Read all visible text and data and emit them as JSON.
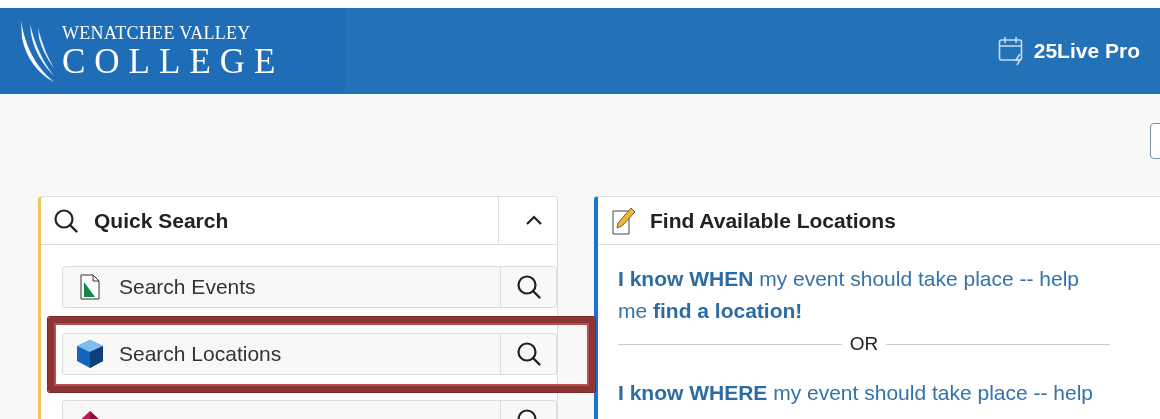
{
  "header": {
    "logo": {
      "line_1": "WENATCHEE VALLEY",
      "line_2": "COLLEGE"
    },
    "product": "25Live Pro"
  },
  "quick_search": {
    "title": "Quick Search",
    "expanded": true,
    "items": [
      {
        "label": "Search Events",
        "kind": "events",
        "highlighted": false
      },
      {
        "label": "Search Locations",
        "kind": "locations",
        "highlighted": true
      },
      {
        "kind": "resources",
        "highlighted": false
      }
    ]
  },
  "find_locations": {
    "title": "Find Available Locations",
    "options": [
      "**I know WHEN** my event should take place -- help me **find a location!**",
      "**I know WHERE** my event should take place -- help"
    ],
    "separator": "OR"
  }
}
